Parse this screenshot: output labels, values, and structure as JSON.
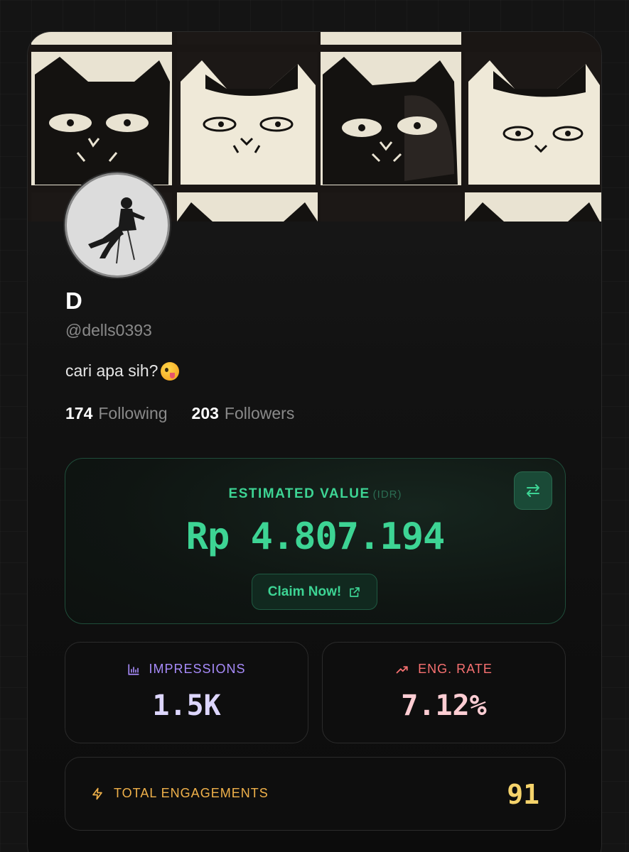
{
  "profile": {
    "name": "D",
    "handle": "@dells0393",
    "bio": "cari apa sih?",
    "bio_emoji": "zany-face-emoji",
    "following_count": "174",
    "following_label": "Following",
    "followers_count": "203",
    "followers_label": "Followers"
  },
  "value": {
    "title": "ESTIMATED VALUE",
    "currency": "(IDR)",
    "amount": "Rp 4.807.194",
    "claim_label": "Claim Now!",
    "swap_icon": "swap-arrows-icon",
    "claim_icon": "external-link-icon"
  },
  "metrics": {
    "impressions": {
      "label": "IMPRESSIONS",
      "value": "1.5K",
      "icon": "bar-chart-icon",
      "color": "#a78bfa"
    },
    "eng_rate": {
      "label": "ENG. RATE",
      "value": "7.12%",
      "icon": "trending-up-icon",
      "color": "#f87171"
    },
    "total": {
      "label": "TOTAL ENGAGEMENTS",
      "value": "91",
      "icon": "lightning-icon",
      "color": "#f0b14a"
    }
  },
  "colors": {
    "accent_green": "#3dd494",
    "background": "#141414"
  }
}
